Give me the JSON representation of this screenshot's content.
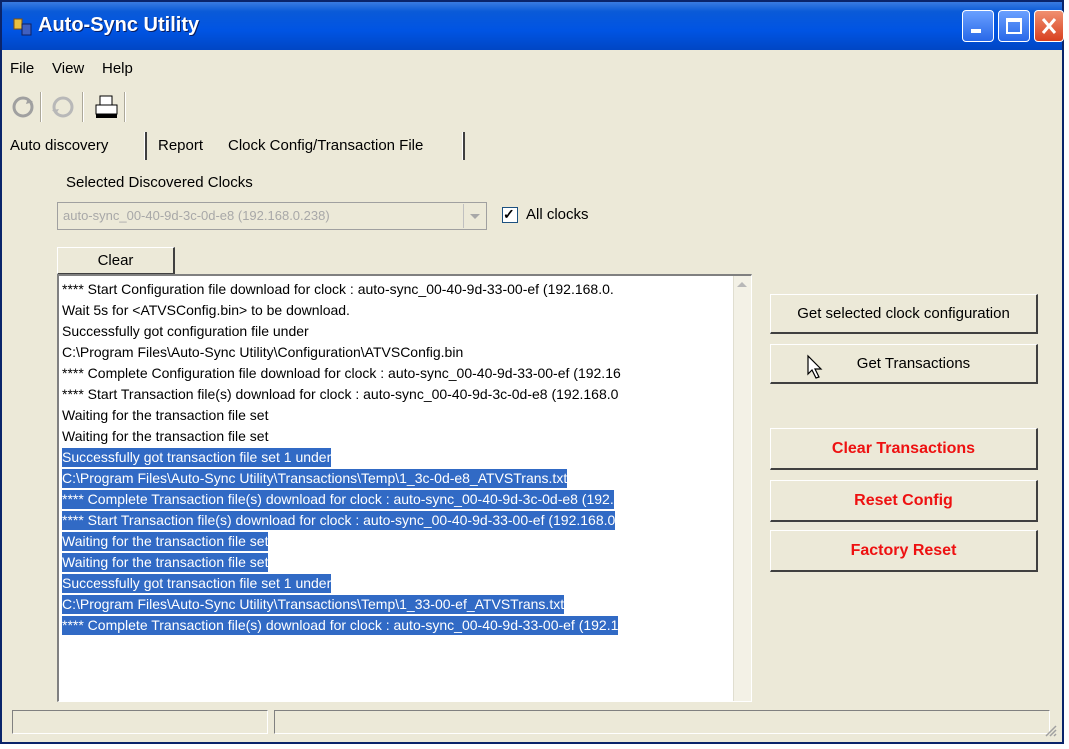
{
  "window": {
    "title": "Auto-Sync Utility",
    "accent_color": "#0054e3",
    "close_color": "#d84020"
  },
  "menu": [
    "File",
    "View",
    "Help"
  ],
  "toolbar": {
    "icons": [
      "sync-icon",
      "sync-disabled-icon",
      "printer-icon"
    ]
  },
  "tabs": [
    "Auto discovery",
    "Report",
    "Clock Config/Transaction File"
  ],
  "active_tab": "Clock Config/Transaction File",
  "clocks": {
    "label": "Selected Discovered Clocks",
    "selected_value": "auto-sync_00-40-9d-3c-0d-e8 (192.168.0.238)",
    "all_clocks_label": "All clocks",
    "all_clocks_checked": true
  },
  "clear_button": "Clear",
  "log": {
    "selection_color": "#316ac5",
    "lines": [
      {
        "text": "**** Start Configuration file download for clock : auto-sync_00-40-9d-33-00-ef (192.168.0.",
        "selected": false
      },
      {
        "text": "Wait 5s for <ATVSConfig.bin> to be download.",
        "selected": false
      },
      {
        "text": "Successfully got configuration file under",
        "selected": false
      },
      {
        "text": "C:\\Program Files\\Auto-Sync Utility\\Configuration\\ATVSConfig.bin",
        "selected": false
      },
      {
        "text": "**** Complete Configuration file download for clock : auto-sync_00-40-9d-33-00-ef (192.16",
        "selected": false
      },
      {
        "text": "**** Start Transaction file(s) download for clock : auto-sync_00-40-9d-3c-0d-e8 (192.168.0",
        "selected": false
      },
      {
        "text": "Waiting for the transaction file set",
        "selected": false
      },
      {
        "text": "Waiting for the transaction file set",
        "selected": false
      },
      {
        "text": "Successfully got transaction file set 1 under",
        "selected": true
      },
      {
        "text": "C:\\Program Files\\Auto-Sync Utility\\Transactions\\Temp\\1_3c-0d-e8_ATVSTrans.txt",
        "selected": true
      },
      {
        "text": "**** Complete Transaction file(s) download for clock : auto-sync_00-40-9d-3c-0d-e8 (192.",
        "selected": true
      },
      {
        "text": "**** Start Transaction file(s) download for clock : auto-sync_00-40-9d-33-00-ef (192.168.0",
        "selected": true
      },
      {
        "text": "Waiting for the transaction file set",
        "selected": true
      },
      {
        "text": "Waiting for the transaction file set",
        "selected": true
      },
      {
        "text": "Successfully got transaction file set 1 under",
        "selected": true
      },
      {
        "text": "C:\\Program Files\\Auto-Sync Utility\\Transactions\\Temp\\1_33-00-ef_ATVSTrans.txt",
        "selected": true
      },
      {
        "text": "**** Complete Transaction file(s) download for clock : auto-sync_00-40-9d-33-00-ef (192.1",
        "selected": true
      }
    ]
  },
  "actions": {
    "get_config": "Get selected clock configuration",
    "get_transactions": "Get Transactions",
    "clear_transactions": "Clear Transactions",
    "reset_config": "Reset Config",
    "factory_reset": "Factory Reset",
    "danger_color": "#ee1111"
  }
}
